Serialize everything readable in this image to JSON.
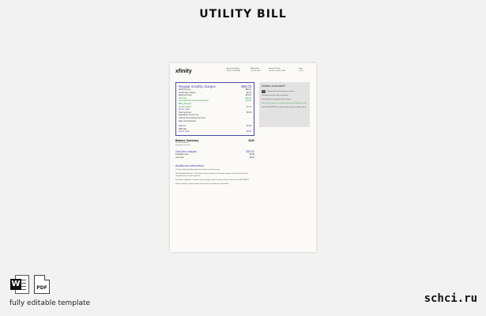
{
  "page": {
    "title": "UTILITY BILL"
  },
  "bill": {
    "logo": "xfinity",
    "account": {
      "col1": [
        "Account Number",
        "8220 12 4567890"
      ],
      "col2": [
        "Billing Date",
        "Jan 08, 2021"
      ],
      "col3": [
        "Service Period",
        "Jan 08 - Feb 07, 2021"
      ],
      "col4": [
        "Page",
        "2 of 4"
      ]
    },
    "monthly": {
      "title": "Regular monthly charges",
      "total": "$90.03",
      "rows": [
        {
          "label": "Xfinity Internet",
          "value": "$80.00",
          "style": ""
        },
        {
          "label": "Performance Starter",
          "value": "$0.75",
          "style": ""
        },
        {
          "label": "Equipment fees",
          "value": "$14.00",
          "style": ""
        },
        {
          "label": "Discounts",
          "value": "-$30.00",
          "style": "green"
        },
        {
          "label": "Automatic Payments and Paperless",
          "value": "$10.00",
          "style": "green"
        },
        {
          "label": "Billing Discount",
          "value": "",
          "style": "green"
        },
        {
          "label": "Service Activity",
          "value": "$6.00",
          "style": "green"
        },
        {
          "label": "Promo credit",
          "value": "",
          "style": "blue"
        },
        {
          "label": "Taxes and fees",
          "value": "$3.42",
          "style": ""
        },
        {
          "label": "Regulatory recovery fee",
          "value": "",
          "style": ""
        },
        {
          "label": "Federal Universal Service Fund",
          "value": "",
          "style": ""
        },
        {
          "label": "State and local taxes",
          "value": "",
          "style": ""
        }
      ],
      "subrows": [
        {
          "label": "Add-ons",
          "value": "$7.99",
          "style": ""
        },
        {
          "label": "HBO Max",
          "value": "",
          "style": ""
        },
        {
          "label": "Promo credit",
          "value": "$0.00",
          "style": "blue"
        }
      ]
    },
    "balance": {
      "title": "Balance Summary",
      "amount": "$120",
      "note1": "Previous balance",
      "note2": "Payments received"
    },
    "onetime": {
      "title": "One-time charges",
      "amount": "$30.03",
      "rows": [
        {
          "label": "Installation fees",
          "value": "$0.00"
        },
        {
          "label": "Late Fees",
          "value": "$0.00"
        }
      ]
    },
    "additional": {
      "title": "Additional information",
      "paras": [
        "Customer Authority Information Visit xfinity.com to learn more.",
        "Non-Regulated Services: The Federal Communications Commission requires certain disclosures for regulated services and equipment.",
        "For Service Upgrades: To add or make changes to your services, please contact us at 1-800-XFINITY.",
        "Privacy: Read our privacy notice to learn how we handle your information."
      ]
    },
    "included": {
      "title": "What's included?",
      "item": "Xfinity Internet Performance Starter",
      "paras": [
        {
          "text": "Get faster speeds with an upgrade.",
          "style": ""
        },
        {
          "text": "Visit xfinity.com/upgrade to learn more.",
          "style": ""
        },
        {
          "text": "Save money when you bundle Internet and Mobile services.",
          "style": "green"
        },
        {
          "text": "Call 1-800-XFINITY for more details about available offers.",
          "style": ""
        }
      ]
    }
  },
  "footer": {
    "word_badge": "W",
    "pdf_label": "PDF",
    "caption": "fully editable template",
    "brand": "schci.ru"
  }
}
